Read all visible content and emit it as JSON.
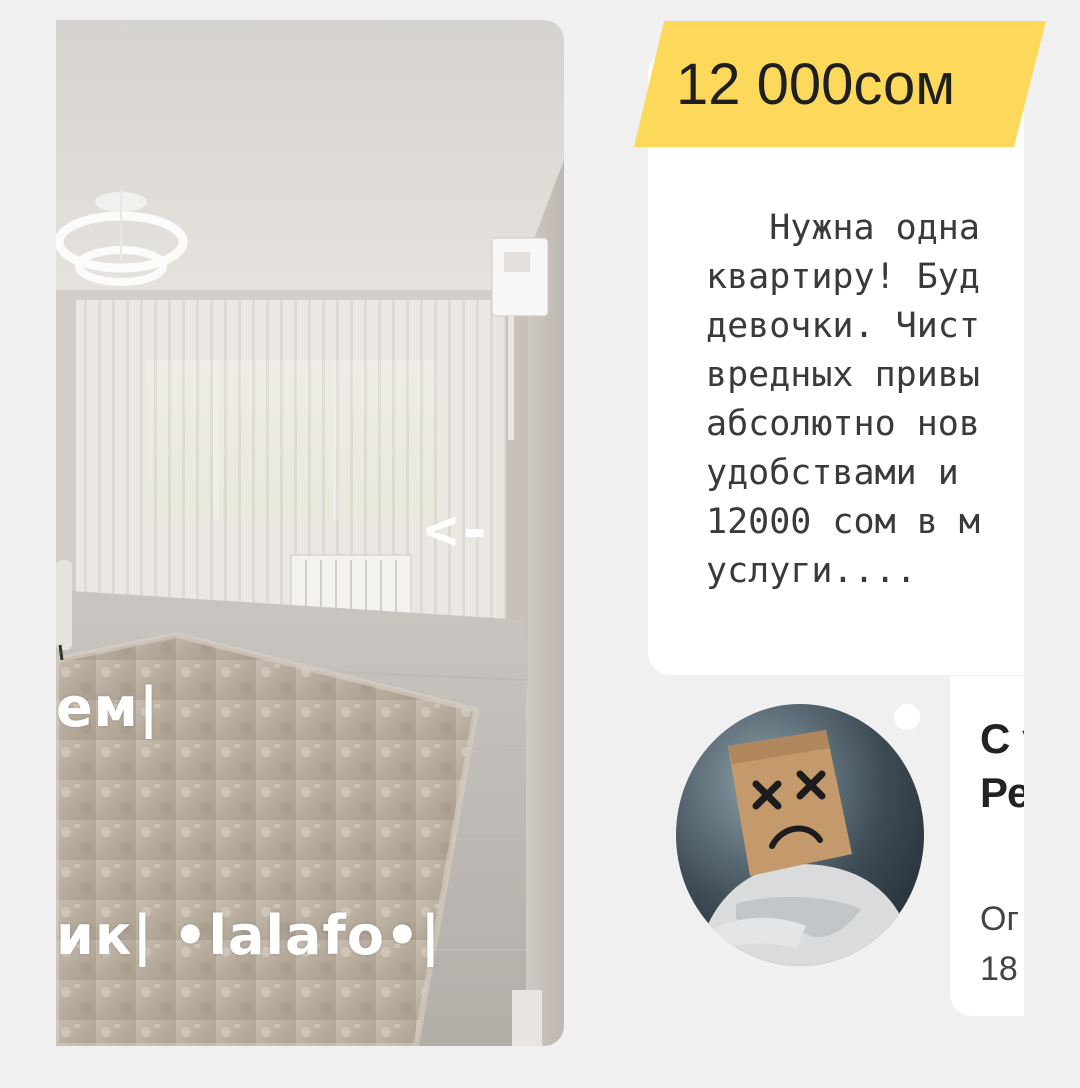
{
  "listing": {
    "price": "12 000сом",
    "description": "   Нужна одна\nквартиру! Буд\nдевочки. Чист\nвредных привы\nабсолютно нов\nудобствами и \n12000 сом в м\nуслуги....",
    "photo": {
      "watermark_line1": "ем|",
      "watermark_line2": "ик|  •lalafo•|",
      "arrow_mark": "<-"
    }
  },
  "seller": {
    "name": "С у\nРе",
    "meta": "Ог\n18",
    "online": true
  },
  "colors": {
    "price_tag": "#FCD95A",
    "card_background": "#ffffff",
    "page_background": "#f0f0f0"
  },
  "icons": {
    "avatar": "paper-bag-sad-face-avatar",
    "online_status": "online-dot-icon"
  }
}
